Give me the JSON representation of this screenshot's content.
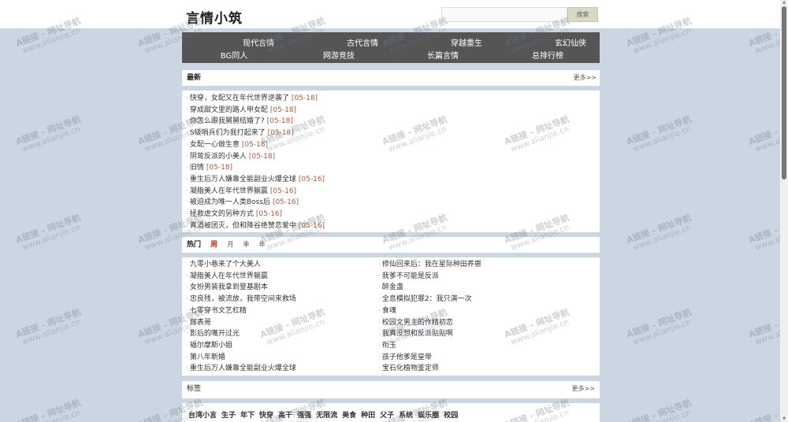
{
  "site": {
    "title": "言情小筑",
    "search_placeholder": "",
    "search_button": "搜索"
  },
  "nav": [
    "现代言情",
    "古代言情",
    "穿越重生",
    "玄幻仙侠",
    "BG同人",
    "网游竞技",
    "长篇言情",
    "总排行榜"
  ],
  "latest": {
    "title": "最新",
    "more": "更多>>",
    "items": [
      {
        "title": "快穿，女配又在年代世界逆袭了",
        "date": "[05-18]"
      },
      {
        "title": "穿成甜文里的路人甲女配",
        "date": "[05-18]"
      },
      {
        "title": "你怎么跟我舅舅结婚了?",
        "date": "[05-18]"
      },
      {
        "title": "S级哨兵们为我打起来了",
        "date": "[05-18]"
      },
      {
        "title": "女配一心做生意",
        "date": "[05-18]"
      },
      {
        "title": "阴鸷反派的小美人",
        "date": "[05-18]"
      },
      {
        "title": "旧情",
        "date": "[05-18]"
      },
      {
        "title": "重生后万人嫌靠全能副业火爆全球",
        "date": "[05-16]"
      },
      {
        "title": "凝脂美人在年代世界躺赢",
        "date": "[05-16]"
      },
      {
        "title": "被迫成为唯一人类Boss后",
        "date": "[05-16]"
      },
      {
        "title": "拯救虐文的另种方式",
        "date": "[05-16]"
      },
      {
        "title": "真酒被团灭，但和降谷绝赞恋爱中",
        "date": "[05-16]"
      }
    ]
  },
  "hot": {
    "title": "热门",
    "tabs": [
      "周",
      "月",
      "季",
      "年"
    ],
    "left": [
      "九零小巷来了个大美人",
      "凝脂美人在年代世界躺赢",
      "女扮男装我拿到登基剧本",
      "忠良残，被流放，我带空间来救场",
      "七零穿书文艺杠精",
      "嫁表哥",
      "影后的嘴开过光",
      "福尔摩斯小姐",
      "第八年新婚",
      "重生后万人嫌靠全能副业火爆全球"
    ],
    "right": [
      "修仙回来后：我在星际种田养崽",
      "我爹不可能是反派",
      "醉金盏",
      "全息模拟犯罪2：我只演一次",
      "食魂",
      "校园文男主的作精初恋",
      "我真没想和反派贴贴啊",
      "衔玉",
      "孩子他爹是皇帝",
      "宝石化植物鉴定师"
    ]
  },
  "tags": {
    "title": "标签",
    "more": "更多>>",
    "items": [
      "台湾小言",
      "生子",
      "年下",
      "快穿",
      "高干",
      "强强",
      "无限流",
      "美食",
      "种田",
      "父子",
      "系统",
      "娱乐圈",
      "校园"
    ]
  },
  "watermark": {
    "line1": "A链接 - 网址导航",
    "line2": "www.alianjie.cn"
  }
}
